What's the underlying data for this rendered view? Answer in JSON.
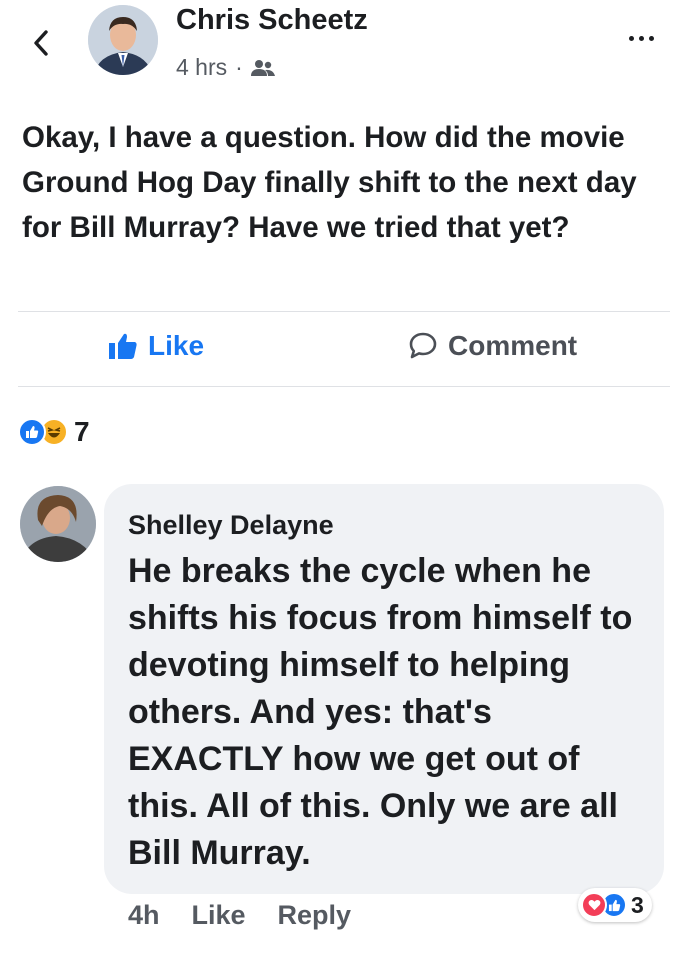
{
  "post": {
    "author": "Chris Scheetz",
    "time": "4 hrs",
    "separator": "·",
    "audience_icon": "friends-icon",
    "text": "Okay, I have a question. How did the movie Ground Hog Day finally shift to the next day for Bill Murray? Have we tried that yet?"
  },
  "actions": {
    "like_label": "Like",
    "comment_label": "Comment"
  },
  "reactions": {
    "types": [
      "like",
      "haha"
    ],
    "count": "7"
  },
  "comment": {
    "author": "Shelley Delayne",
    "text": "He breaks the cycle when he shifts his focus from himself to devoting himself to helping others. And yes: that's EXACTLY how we get out of this. All of this. Only we are all Bill Murray.",
    "time": "4h",
    "like_label": "Like",
    "reply_label": "Reply",
    "reaction_types": [
      "love",
      "like"
    ],
    "reaction_count": "3"
  },
  "colors": {
    "accent": "#1877f2",
    "love": "#f33e58",
    "haha": "#f7b125",
    "bubble_bg": "#f0f2f5"
  }
}
